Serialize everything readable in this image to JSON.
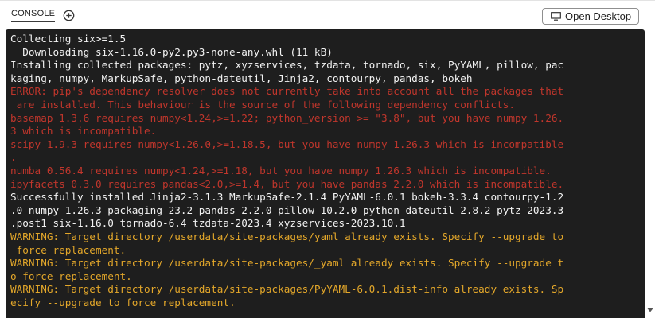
{
  "tabs": [
    {
      "label": "CONSOLE",
      "active": true
    }
  ],
  "add_tab_icon": "plus-circle-icon",
  "open_desktop": {
    "label": "Open Desktop",
    "icon": "desktop-icon"
  },
  "colors": {
    "console_bg": "#1e1e1e",
    "text_default": "#f2f2f2",
    "text_error": "#c0362c",
    "text_warning": "#e3a72a"
  },
  "console_lines": [
    {
      "text": "Collecting six>=1.5",
      "kind": "default"
    },
    {
      "text": "  Downloading six-1.16.0-py2.py3-none-any.whl (11 kB)",
      "kind": "default"
    },
    {
      "text": "Installing collected packages: pytz, xyzservices, tzdata, tornado, six, PyYAML, pillow, pac",
      "kind": "default"
    },
    {
      "text": "kaging, numpy, MarkupSafe, python-dateutil, Jinja2, contourpy, pandas, bokeh",
      "kind": "default"
    },
    {
      "text": "ERROR: pip's dependency resolver does not currently take into account all the packages that",
      "kind": "error"
    },
    {
      "text": " are installed. This behaviour is the source of the following dependency conflicts.",
      "kind": "error"
    },
    {
      "text": "basemap 1.3.6 requires numpy<1.24,>=1.22; python_version >= \"3.8\", but you have numpy 1.26.",
      "kind": "error"
    },
    {
      "text": "3 which is incompatible.",
      "kind": "error"
    },
    {
      "text": "scipy 1.9.3 requires numpy<1.26.0,>=1.18.5, but you have numpy 1.26.3 which is incompatible",
      "kind": "error"
    },
    {
      "text": ".",
      "kind": "error"
    },
    {
      "text": "numba 0.56.4 requires numpy<1.24,>=1.18, but you have numpy 1.26.3 which is incompatible.",
      "kind": "error"
    },
    {
      "text": "ipyfacets 0.3.0 requires pandas<2.0,>=1.4, but you have pandas 2.2.0 which is incompatible.",
      "kind": "error"
    },
    {
      "text": "Successfully installed Jinja2-3.1.3 MarkupSafe-2.1.4 PyYAML-6.0.1 bokeh-3.3.4 contourpy-1.2",
      "kind": "default"
    },
    {
      "text": ".0 numpy-1.26.3 packaging-23.2 pandas-2.2.0 pillow-10.2.0 python-dateutil-2.8.2 pytz-2023.3",
      "kind": "default"
    },
    {
      "text": ".post1 six-1.16.0 tornado-6.4 tzdata-2023.4 xyzservices-2023.10.1",
      "kind": "default"
    },
    {
      "text": "WARNING: Target directory /userdata/site-packages/yaml already exists. Specify --upgrade to",
      "kind": "warning"
    },
    {
      "text": " force replacement.",
      "kind": "warning"
    },
    {
      "text": "WARNING: Target directory /userdata/site-packages/_yaml already exists. Specify --upgrade t",
      "kind": "warning"
    },
    {
      "text": "o force replacement.",
      "kind": "warning"
    },
    {
      "text": "WARNING: Target directory /userdata/site-packages/PyYAML-6.0.1.dist-info already exists. Sp",
      "kind": "warning"
    },
    {
      "text": "ecify --upgrade to force replacement.",
      "kind": "warning"
    }
  ],
  "scroll_icon": "chevron-down-icon"
}
